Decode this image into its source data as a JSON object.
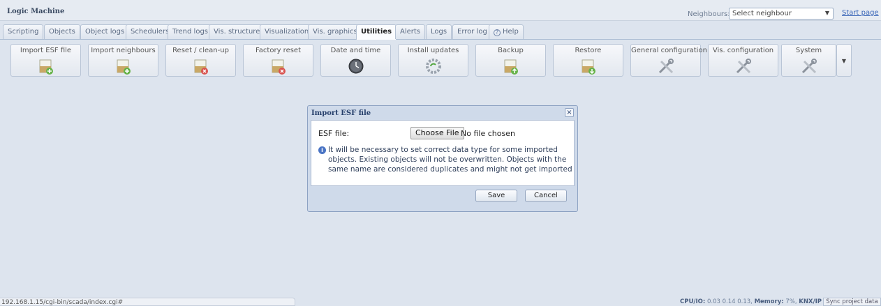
{
  "app": {
    "title": "Logic Machine"
  },
  "header": {
    "neighbours_label": "Neighbours:",
    "neighbour_select": "Select neighbour",
    "start_page": "Start page"
  },
  "tabs": [
    {
      "label": "Scripting"
    },
    {
      "label": "Objects"
    },
    {
      "label": "Object logs"
    },
    {
      "label": "Schedulers"
    },
    {
      "label": "Trend logs"
    },
    {
      "label": "Vis. structure"
    },
    {
      "label": "Visualization"
    },
    {
      "label": "Vis. graphics"
    },
    {
      "label": "Utilities",
      "active": true
    },
    {
      "label": "Alerts"
    },
    {
      "label": "Logs"
    },
    {
      "label": "Error log"
    },
    {
      "label": "Help"
    }
  ],
  "toolbar": [
    {
      "label": "Import ESF file",
      "icon": "import-esf-icon"
    },
    {
      "label": "Import neighbours",
      "icon": "import-neighbours-icon"
    },
    {
      "label": "Reset / clean-up",
      "icon": "reset-icon"
    },
    {
      "label": "Factory reset",
      "icon": "factory-reset-icon"
    },
    {
      "label": "Date and time",
      "icon": "clock-icon"
    },
    {
      "label": "Install updates",
      "icon": "gear-update-icon"
    },
    {
      "label": "Backup",
      "icon": "backup-icon"
    },
    {
      "label": "Restore",
      "icon": "restore-icon"
    },
    {
      "label": "General configuration",
      "icon": "tools-icon"
    },
    {
      "label": "Vis. configuration",
      "icon": "tools-icon"
    },
    {
      "label": "System",
      "icon": "tools-icon"
    }
  ],
  "dialog": {
    "title": "Import ESF file",
    "field_label": "ESF file:",
    "choose_file": "Choose File",
    "no_file": "No file chosen",
    "info": "It will be necessary to set correct data type for some imported objects. Existing objects will not be overwritten. Objects with the same name are considered duplicates and might not get imported",
    "save": "Save",
    "cancel": "Cancel"
  },
  "status": {
    "url": "192.168.1.15/cgi-bin/scada/index.cgi#",
    "cpu_label": "CPU/IO:",
    "cpu_value": "0.03 0.14 0.13,",
    "memory_label": "Memory:",
    "memory_value": "7%,",
    "knx_label": "KNX/IP",
    "sync": "Sync project data"
  }
}
